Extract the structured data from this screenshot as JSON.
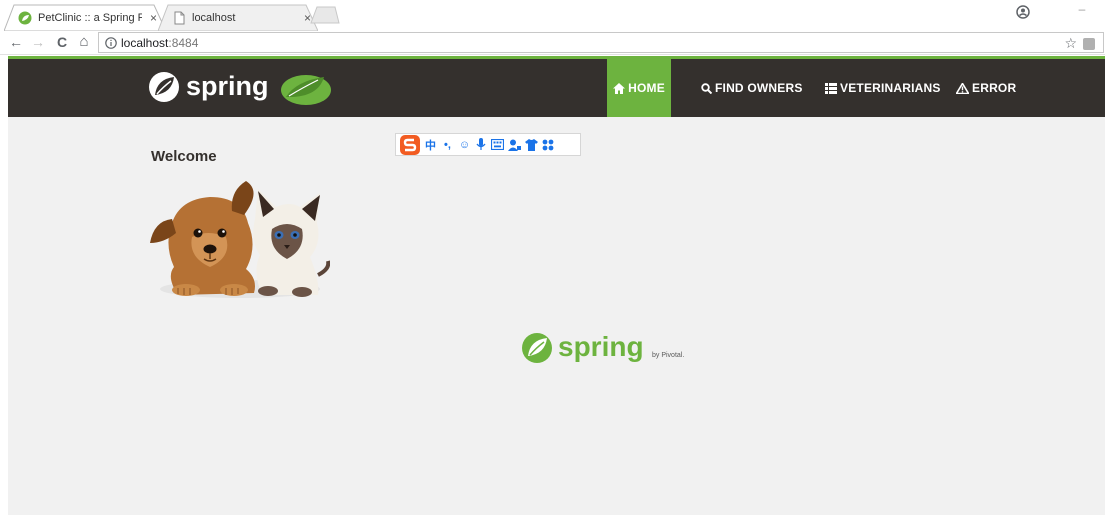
{
  "browser": {
    "tabs": [
      {
        "title": "PetClinic :: a Spring Fra",
        "active": true,
        "close": "×"
      },
      {
        "title": "localhost",
        "active": false,
        "close": "×"
      }
    ],
    "window_controls": {
      "minimize": "–"
    },
    "address_bar": {
      "host": "localhost",
      "port": ":8484"
    },
    "icons": {
      "back": "←",
      "forward": "→",
      "reload": "C",
      "home": "⌂",
      "star": "☆"
    }
  },
  "navbar": {
    "brand": "spring",
    "items": [
      {
        "label": "HOME",
        "icon": "home-icon",
        "active": true
      },
      {
        "label": "FIND OWNERS",
        "icon": "search-icon",
        "active": false
      },
      {
        "label": "VETERINARIANS",
        "icon": "list-icon",
        "active": false
      },
      {
        "label": "ERROR",
        "icon": "warning-icon",
        "active": false
      }
    ]
  },
  "main": {
    "heading": "Welcome",
    "image": "pets-image"
  },
  "ime_toolbar": {
    "items": [
      "中",
      "•,",
      "☺",
      "mic",
      "kbd",
      "user",
      "shirt",
      "apps"
    ]
  },
  "footer": {
    "brand": "spring",
    "tagline": "by Pivotal."
  },
  "colors": {
    "accent": "#6db33f",
    "navbar_bg": "#34302d",
    "page_bg": "#f1f1f1"
  }
}
